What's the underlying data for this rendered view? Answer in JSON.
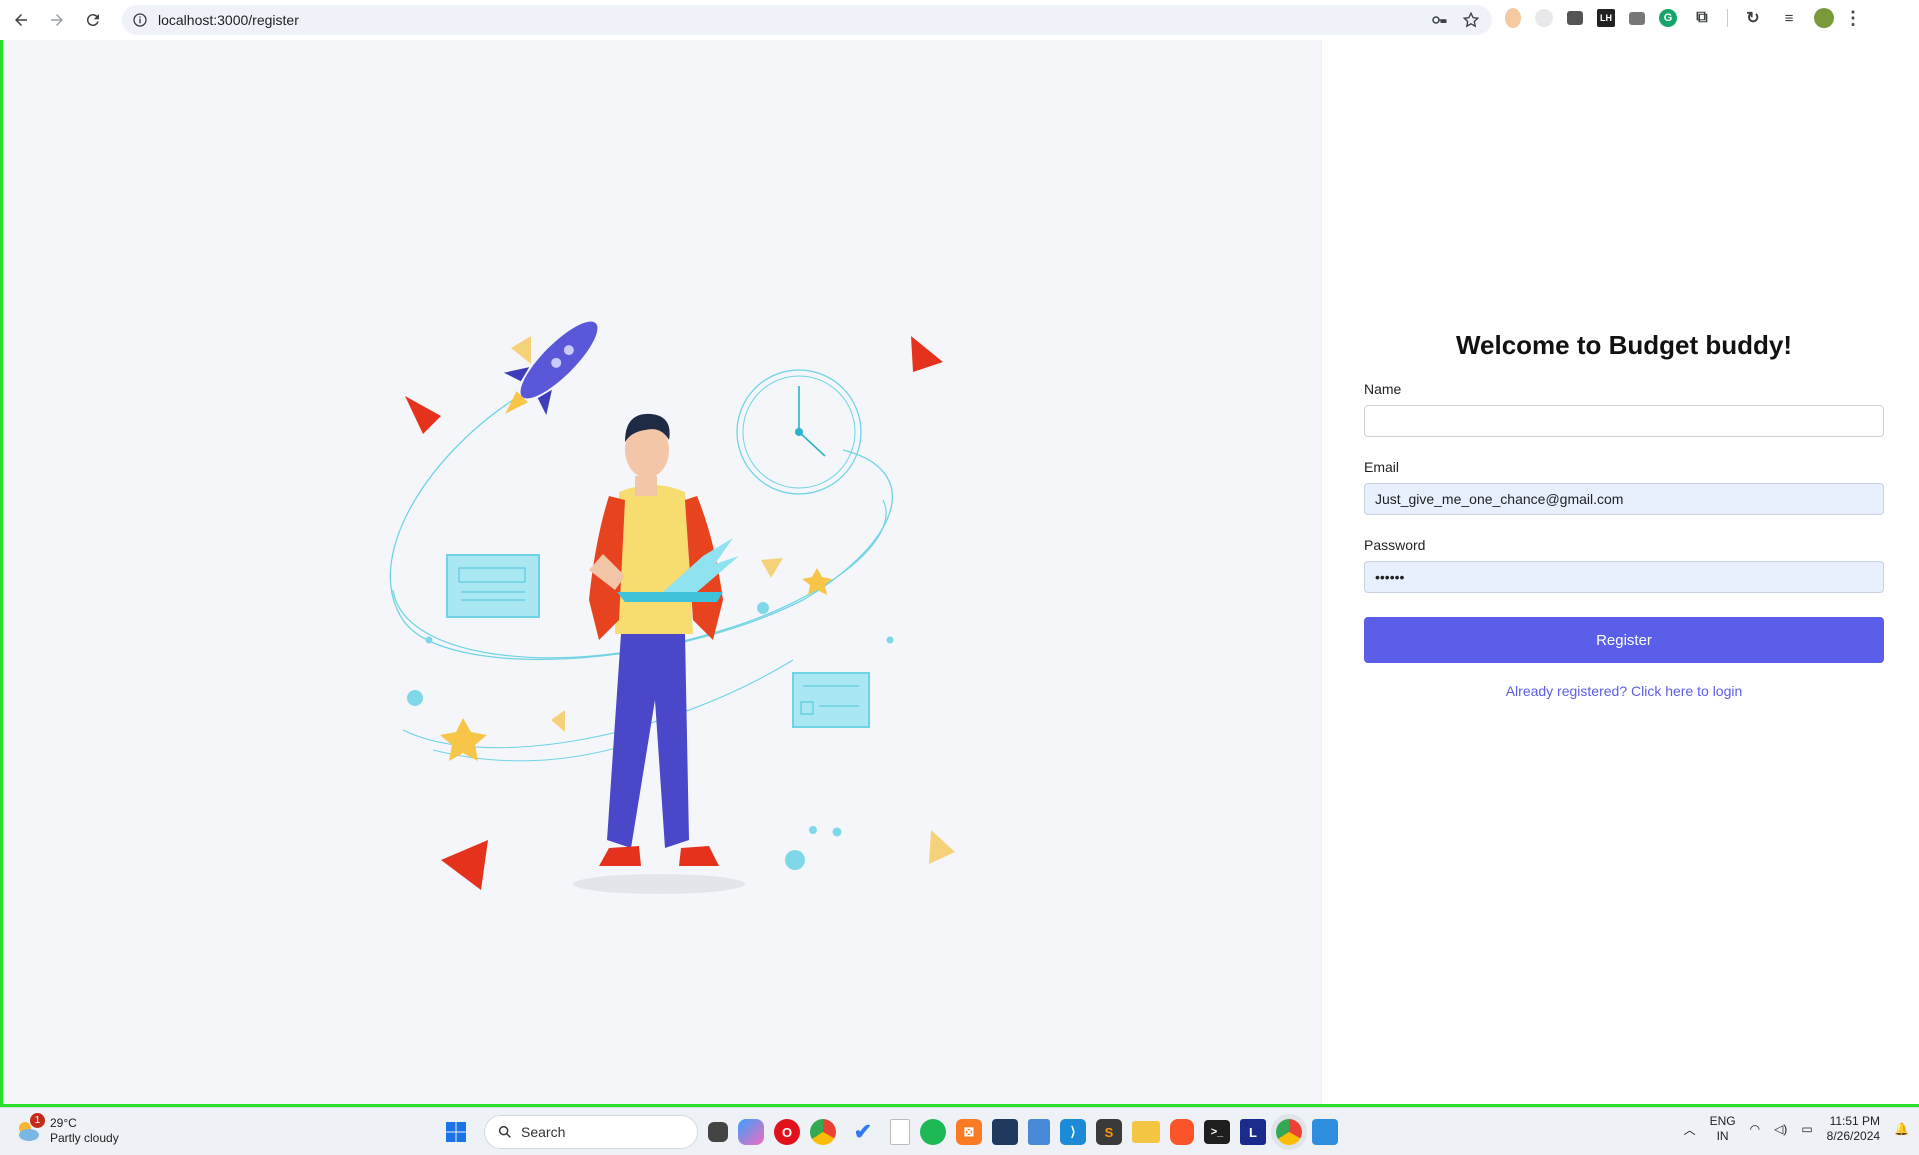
{
  "browser": {
    "url": "localhost:3000/register",
    "extensions": [
      "honey-icon",
      "capture-icon",
      "tab-icon",
      "lighthouse-icon",
      "camera-icon",
      "grammarly-icon",
      "puzzle-icon",
      "sync-icon",
      "media-icon",
      "profile-avatar"
    ]
  },
  "form": {
    "title": "Welcome to Budget buddy!",
    "name_label": "Name",
    "name_value": "",
    "email_label": "Email",
    "email_value": "Just_give_me_one_chance@gmail.com",
    "password_label": "Password",
    "password_value": "••••••",
    "register_label": "Register",
    "login_link": "Already registered? Click here to login"
  },
  "taskbar": {
    "weather_badge": "1",
    "temperature": "29°C",
    "condition": "Partly cloudy",
    "search_placeholder": "Search",
    "lang_top": "ENG",
    "lang_bottom": "IN",
    "time": "11:51 PM",
    "date": "8/26/2024"
  },
  "colors": {
    "accent": "#5a5ee8",
    "viewport_border": "#28e028",
    "autofill_bg": "#e8f0fe"
  }
}
